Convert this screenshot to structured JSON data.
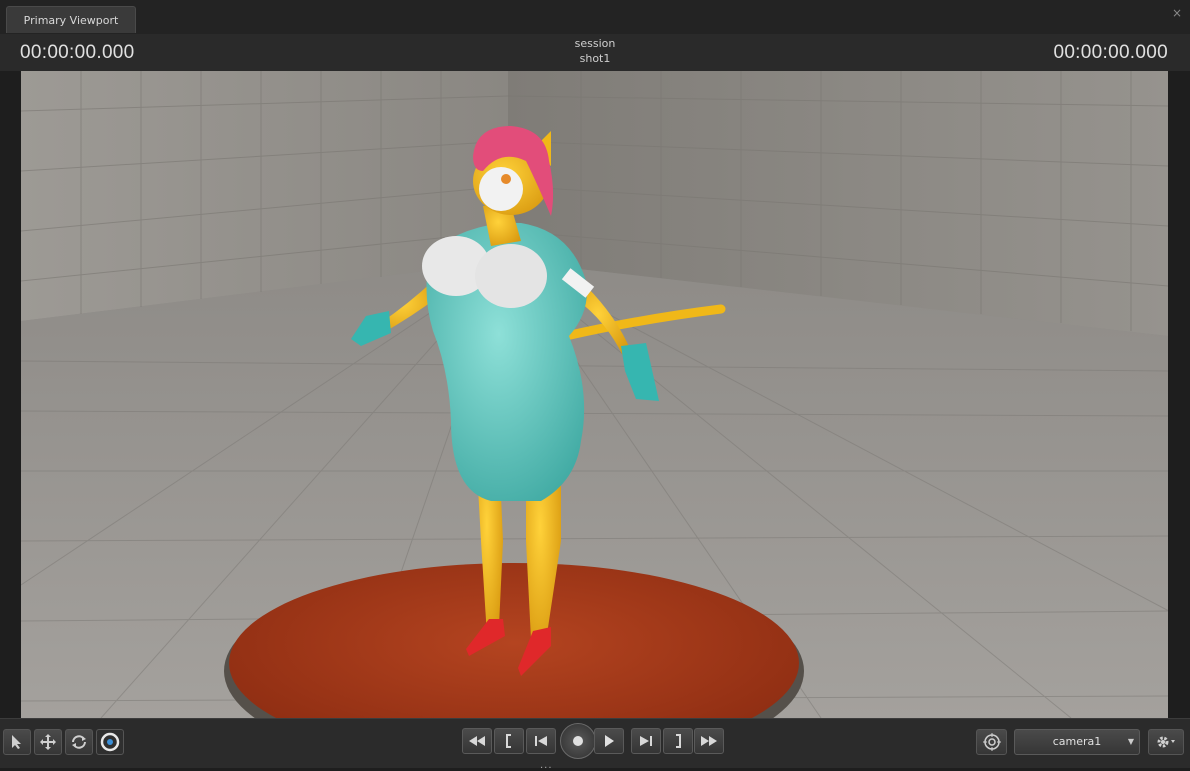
{
  "tab": {
    "label": "Primary Viewport",
    "close": "×"
  },
  "header": {
    "timecode_left": "00:00:00.000",
    "timecode_right": "00:00:00.000",
    "session": "session",
    "shot": "shot1"
  },
  "toolbar": {
    "tools": [
      {
        "name": "select-tool",
        "icon": "arrow-cursor-icon"
      },
      {
        "name": "move-tool",
        "icon": "move-cross-icon"
      },
      {
        "name": "rotate-tool",
        "icon": "rotate-icon"
      },
      {
        "name": "orbit-tool",
        "icon": "orbit-target-icon",
        "active": true
      }
    ],
    "playback": [
      {
        "name": "rewind-button",
        "icon": "rewind-icon"
      },
      {
        "name": "mark-in-button",
        "icon": "bracket-in-icon"
      },
      {
        "name": "prev-frame-button",
        "icon": "skip-back-icon"
      },
      {
        "name": "record-button",
        "icon": "record-icon"
      },
      {
        "name": "play-button",
        "icon": "play-icon"
      },
      {
        "name": "next-frame-button",
        "icon": "skip-forward-icon"
      },
      {
        "name": "mark-out-button",
        "icon": "bracket-out-icon"
      },
      {
        "name": "fast-forward-button",
        "icon": "fast-forward-icon"
      }
    ],
    "camera_select": "camera1",
    "grip": "..."
  },
  "colors": {
    "accent_active": "#3a8fd8",
    "platform": "#a33a1a",
    "outfit": "#6fd0c8",
    "skin": "#f2b81e",
    "hair": "#e0507a"
  }
}
